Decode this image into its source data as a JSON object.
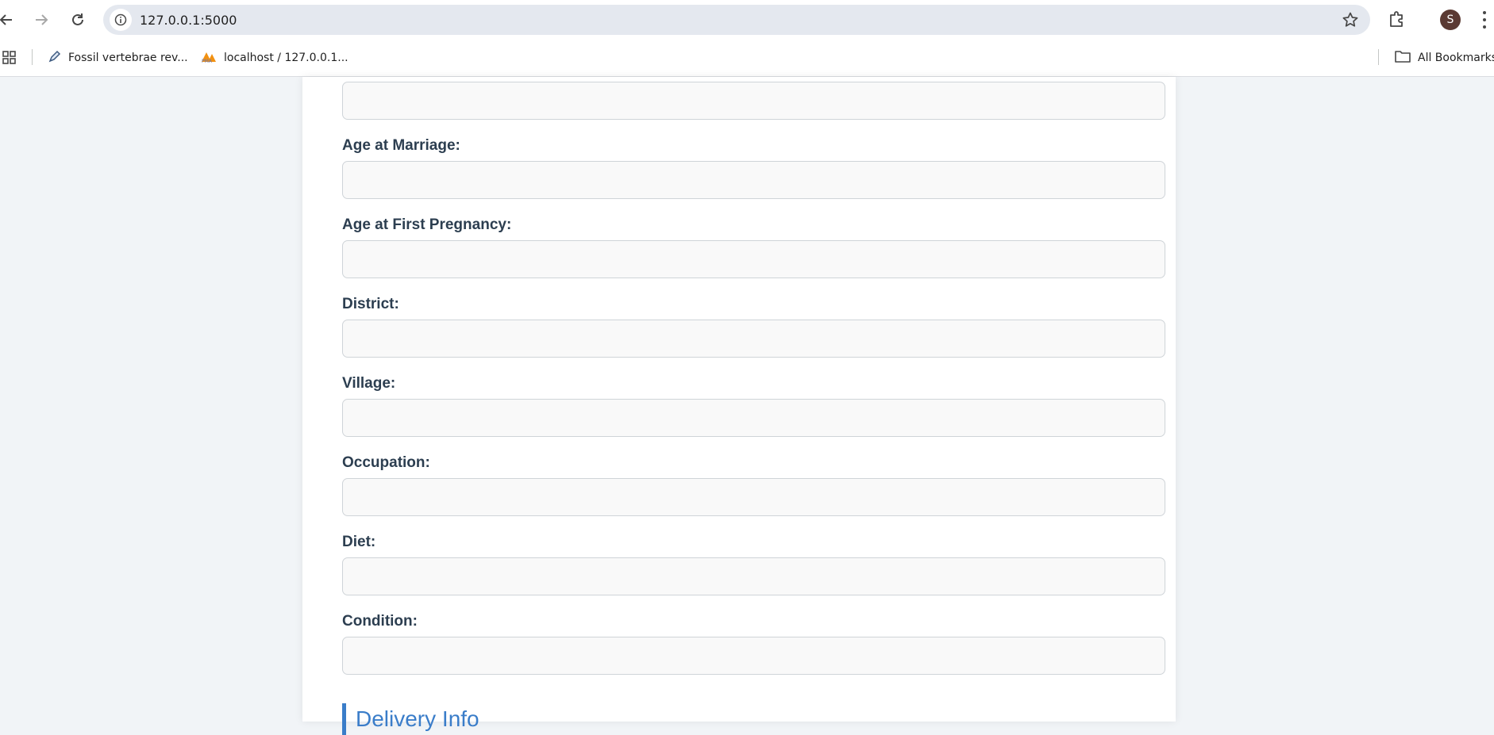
{
  "browser": {
    "url": "127.0.0.1:5000",
    "profile_initial": "S",
    "bookmarks": [
      {
        "label": "Fossil vertebrae rev..."
      },
      {
        "label": "localhost / 127.0.0.1..."
      }
    ],
    "all_bookmarks_label": "All Bookmarks"
  },
  "form": {
    "fields": [
      {
        "label": "Age at Marriage:"
      },
      {
        "label": "Age at First Pregnancy:"
      },
      {
        "label": "District:"
      },
      {
        "label": "Village:"
      },
      {
        "label": "Occupation:"
      },
      {
        "label": "Diet:"
      },
      {
        "label": "Condition:"
      }
    ],
    "next_section_title": "Delivery Info"
  },
  "colors": {
    "accent": "#3a7dc9",
    "label_text": "#2c3e50",
    "page_bg": "#f1f4f7"
  }
}
